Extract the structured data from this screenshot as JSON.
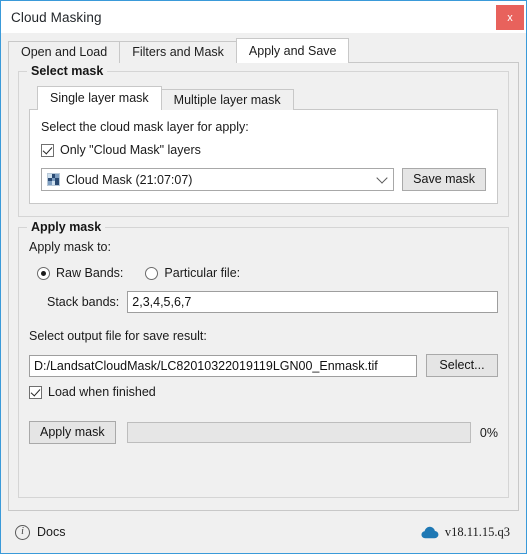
{
  "window": {
    "title": "Cloud Masking",
    "close_label": "x"
  },
  "tabs": [
    {
      "label": "Open and Load",
      "active": false
    },
    {
      "label": "Filters and Mask",
      "active": false
    },
    {
      "label": "Apply and Save",
      "active": true
    }
  ],
  "select_mask": {
    "group_title": "Select mask",
    "inner_tabs": [
      {
        "label": "Single layer mask",
        "active": true
      },
      {
        "label": "Multiple layer mask",
        "active": false
      }
    ],
    "instruction": "Select the cloud mask layer for apply:",
    "only_cloud_mask_checkbox": {
      "label": "Only \"Cloud Mask\" layers",
      "checked": true
    },
    "layer_combo": {
      "value": "Cloud Mask (21:07:07)",
      "icon": "raster-layer-icon"
    },
    "save_mask_button": "Save mask"
  },
  "apply_mask": {
    "group_title": "Apply mask",
    "apply_to_label": "Apply mask to:",
    "radios": [
      {
        "label": "Raw Bands:",
        "selected": true
      },
      {
        "label": "Particular file:",
        "selected": false
      }
    ],
    "stack_bands_label": "Stack bands:",
    "stack_bands_value": "2,3,4,5,6,7",
    "output_label": "Select output file for save result:",
    "output_path": "D:/LandsatCloudMask/LC82010322019119LGN00_Enmask.tif",
    "select_button": "Select...",
    "load_when_finished": {
      "label": "Load when finished",
      "checked": true
    },
    "apply_button": "Apply mask",
    "progress_percent": 0,
    "progress_label": "0%"
  },
  "footer": {
    "docs_label": "Docs",
    "docs_icon": "info-icon",
    "version": "v18.11.15.q3",
    "version_icon": "cloud-icon"
  },
  "colors": {
    "accent_blue": "#3a9ad9",
    "close_red": "#e8625c",
    "window_bg": "#f0f0f0",
    "panel_white": "#ffffff",
    "cloud_icon_blue": "#1e78b4"
  }
}
